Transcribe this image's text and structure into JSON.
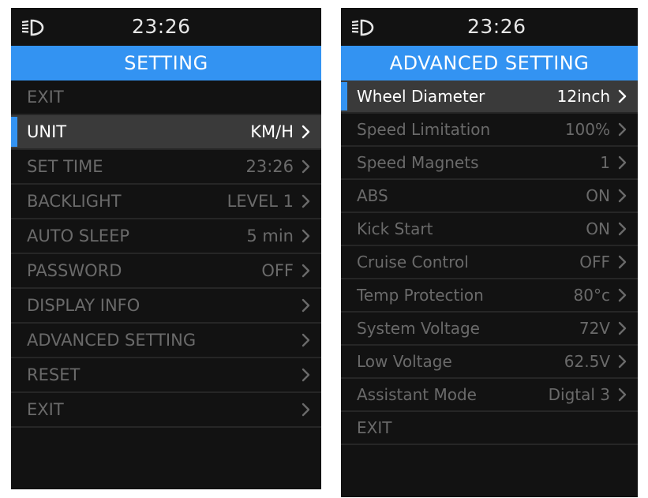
{
  "left_screen": {
    "status": {
      "time": "23:26",
      "icon": "headlight-icon"
    },
    "title": "SETTING",
    "rows": [
      {
        "label": "EXIT",
        "value": "",
        "chevron": false,
        "selected": false
      },
      {
        "label": "UNIT",
        "value": "KM/H",
        "chevron": true,
        "selected": true
      },
      {
        "label": "SET TIME",
        "value": "23:26",
        "chevron": true,
        "selected": false
      },
      {
        "label": "BACKLIGHT",
        "value": "LEVEL 1",
        "chevron": true,
        "selected": false
      },
      {
        "label": "AUTO SLEEP",
        "value": "5 min",
        "chevron": true,
        "selected": false
      },
      {
        "label": "PASSWORD",
        "value": "OFF",
        "chevron": true,
        "selected": false
      },
      {
        "label": "DISPLAY INFO",
        "value": "",
        "chevron": true,
        "selected": false
      },
      {
        "label": "ADVANCED SETTING",
        "value": "",
        "chevron": true,
        "selected": false
      },
      {
        "label": "RESET",
        "value": "",
        "chevron": true,
        "selected": false
      },
      {
        "label": "EXIT",
        "value": "",
        "chevron": true,
        "selected": false
      }
    ]
  },
  "right_screen": {
    "status": {
      "time": "23:26",
      "icon": "headlight-icon"
    },
    "title": "ADVANCED SETTING",
    "rows": [
      {
        "label": "Wheel Diameter",
        "value": "12inch",
        "chevron": true,
        "selected": true
      },
      {
        "label": "Speed Limitation",
        "value": "100%",
        "chevron": true,
        "selected": false
      },
      {
        "label": "Speed Magnets",
        "value": "1",
        "chevron": true,
        "selected": false
      },
      {
        "label": "ABS",
        "value": "ON",
        "chevron": true,
        "selected": false
      },
      {
        "label": "Kick Start",
        "value": "ON",
        "chevron": true,
        "selected": false
      },
      {
        "label": "Cruise Control",
        "value": "OFF",
        "chevron": true,
        "selected": false
      },
      {
        "label": "Temp Protection",
        "value": "80°c",
        "chevron": true,
        "selected": false
      },
      {
        "label": "System Voltage",
        "value": "72V",
        "chevron": true,
        "selected": false
      },
      {
        "label": "Low Voltage",
        "value": "62.5V",
        "chevron": true,
        "selected": false
      },
      {
        "label": "Assistant Mode",
        "value": "Digtal 3",
        "chevron": true,
        "selected": false
      },
      {
        "label": "EXIT",
        "value": "",
        "chevron": false,
        "selected": false
      }
    ]
  },
  "colors": {
    "accent": "#3393f2",
    "background": "#121212",
    "selected_row": "#3a3a3a",
    "dim_text": "#6a6a6a",
    "bright_text": "#ffffff"
  }
}
